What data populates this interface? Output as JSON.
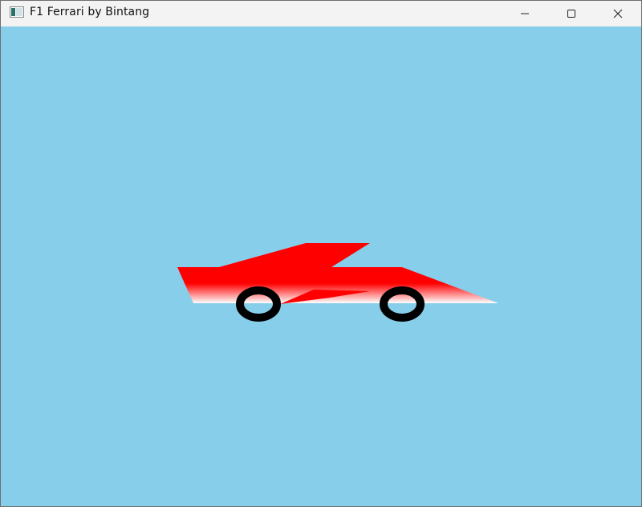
{
  "window": {
    "title": "F1 Ferrari by Bintang",
    "controls": {
      "minimize_icon": "minimize-icon",
      "maximize_icon": "maximize-icon",
      "close_icon": "close-icon"
    }
  },
  "scene": {
    "background_color": "#87CEEB",
    "car": {
      "body_top_color": "#FF0000",
      "body_bottom_color": "#FFFFFF",
      "wheel_color": "#000000"
    }
  }
}
